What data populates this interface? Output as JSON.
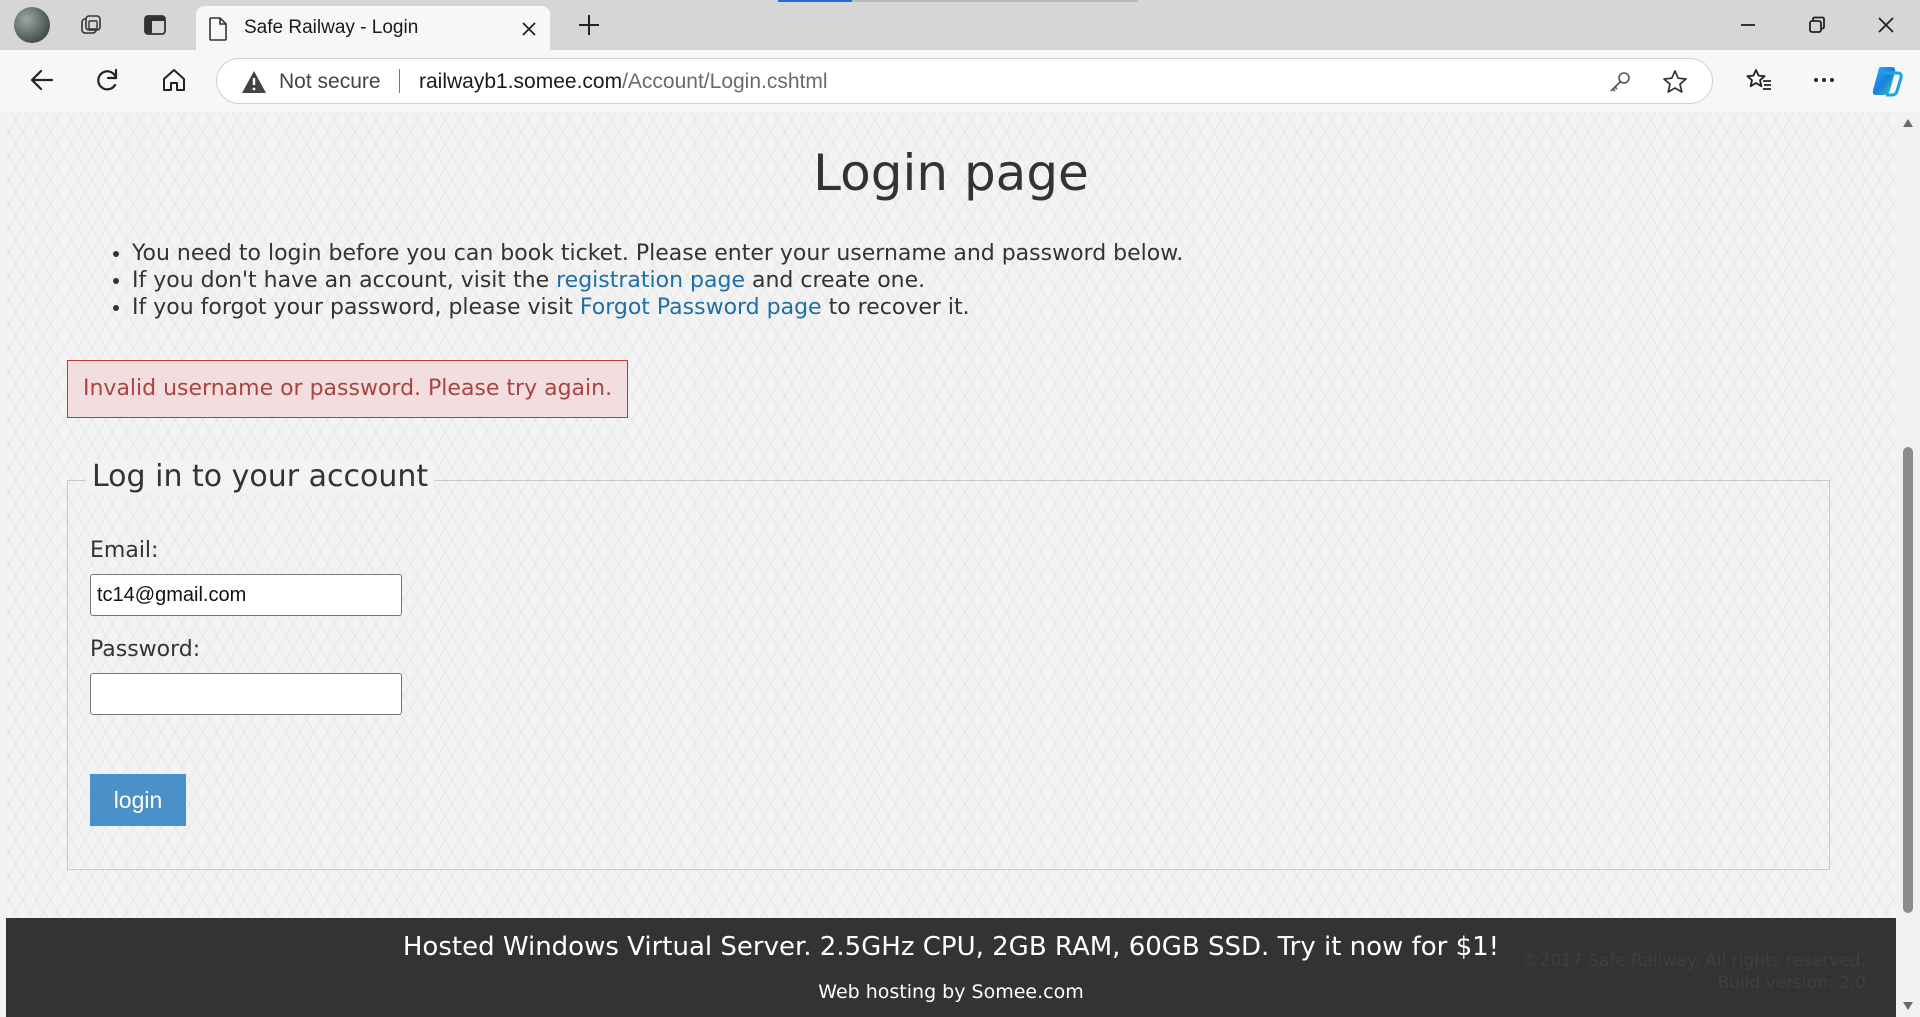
{
  "browser": {
    "tab": {
      "title": "Safe Railway - Login"
    },
    "address": {
      "security_label": "Not secure",
      "domain": "railwayb1.somee.com",
      "path": "/Account/Login.cshtml"
    }
  },
  "page": {
    "title": "Login page",
    "info": {
      "line1": "You need to login before you can book ticket. Please enter your username and password below.",
      "line2_prefix": "If you don't have an account, visit the ",
      "line2_link": "registration page",
      "line2_suffix": " and create one.",
      "line3_prefix": "If you forgot your password, please visit ",
      "line3_link": "Forgot Password page",
      "line3_suffix": " to recover it."
    },
    "error_message": "Invalid username or password. Please try again.",
    "form": {
      "legend": "Log in to your account",
      "email_label": "Email:",
      "email_value": "tc14@gmail.com",
      "password_label": "Password:",
      "password_value": "",
      "submit_label": "login"
    },
    "footer": {
      "ad_text": "Hosted Windows Virtual Server. 2.5GHz CPU, 2GB RAM, 60GB SSD. Try it now for $1!",
      "hosting_text": "Web hosting by Somee.com",
      "copyright": "©2017 Safe Railway. All rights reserved.",
      "build_version": "Build version: 2.0"
    }
  },
  "colors": {
    "link": "#1d6fa5",
    "error_bg": "#f2dede",
    "error_border": "#c0392b",
    "error_text": "#a94442",
    "button_bg": "#4a90c9",
    "footer_bg": "#333333",
    "loading_accent": "#1f6fd6"
  },
  "icons": [
    "profile-avatar",
    "workspaces-icon",
    "tab-actions-icon",
    "page-icon",
    "close-icon",
    "plus-icon",
    "minimize-icon",
    "restore-icon",
    "back-icon",
    "refresh-icon",
    "home-icon",
    "warning-icon",
    "key-icon",
    "star-icon",
    "favorites-icon",
    "more-icon",
    "copilot-icon"
  ]
}
